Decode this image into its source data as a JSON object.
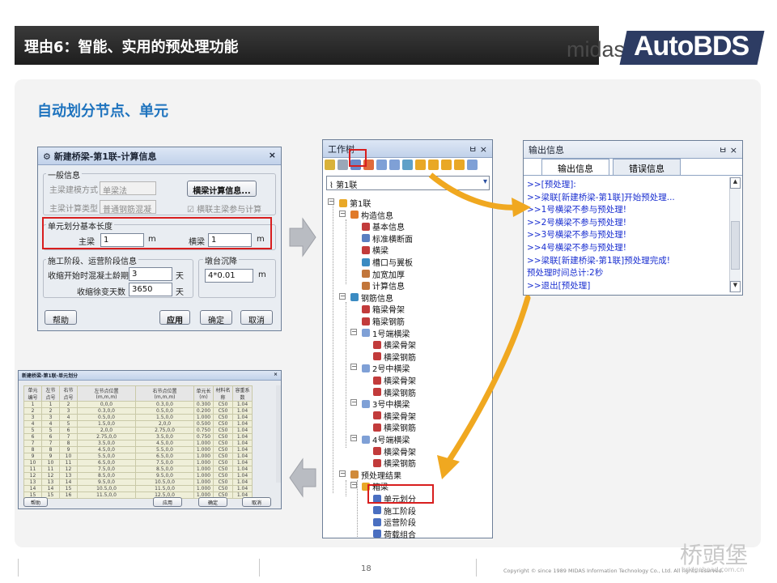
{
  "header": {
    "title": "理由6：智能、实用的预处理功能",
    "logo_midas": "midas",
    "logo_product": "AutoBDS"
  },
  "subtitle": "自动划分节点、单元",
  "dialog": {
    "title": "新建桥梁-第1联-计算信息",
    "close": "×",
    "general_group": "一般信息",
    "model_method_label": "主梁建模方式",
    "model_method_value": "单梁法",
    "calc_type_label": "主梁计算类型",
    "calc_type_value": "普通钢筋混凝",
    "crossbeam_button": "横梁计算信息...",
    "crossbeam_check_label": "横联主梁参与计算",
    "element_group": "单元划分基本长度",
    "main_beam_label": "主梁",
    "main_beam_value": "1",
    "main_beam_unit": "m",
    "crossbeam_label": "横梁",
    "crossbeam_value": "1",
    "crossbeam_unit": "m",
    "stage_group": "施工阶段、运营阶段信息",
    "shrink_start_label": "收缩开始时混凝土龄期",
    "shrink_start_value": "3",
    "shrink_start_unit": "天",
    "shrink_days_label": "收缩徐变天数",
    "shrink_days_value": "3650",
    "shrink_days_unit": "天",
    "settle_group": "墩台沉降",
    "settle_value": "4*0.01",
    "settle_unit": "m",
    "help_button": "帮助",
    "apply_button": "应用",
    "ok_button": "确定",
    "cancel_button": "取消"
  },
  "tree": {
    "title": "工作树",
    "pin": "ㅂ",
    "close": "×",
    "selector": "第1联",
    "nodes": [
      {
        "label": "第1联"
      },
      {
        "label": "构造信息"
      },
      {
        "label": "基本信息"
      },
      {
        "label": "标准横断面"
      },
      {
        "label": "横梁"
      },
      {
        "label": "槽口与翼板"
      },
      {
        "label": "加宽加厚"
      },
      {
        "label": "计算信息"
      },
      {
        "label": "钢筋信息"
      },
      {
        "label": "箱梁骨架"
      },
      {
        "label": "箱梁钢筋"
      },
      {
        "label": "1号端横梁"
      },
      {
        "label": "横梁骨架"
      },
      {
        "label": "横梁钢筋"
      },
      {
        "label": "2号中横梁"
      },
      {
        "label": "横梁骨架"
      },
      {
        "label": "横梁钢筋"
      },
      {
        "label": "3号中横梁"
      },
      {
        "label": "横梁骨架"
      },
      {
        "label": "横梁钢筋"
      },
      {
        "label": "4号端横梁"
      },
      {
        "label": "横梁骨架"
      },
      {
        "label": "横梁钢筋"
      },
      {
        "label": "预处理结果"
      },
      {
        "label": "箱梁"
      },
      {
        "label": "单元划分"
      },
      {
        "label": "施工阶段"
      },
      {
        "label": "运营阶段"
      },
      {
        "label": "荷载组合"
      }
    ]
  },
  "output": {
    "title": "输出信息",
    "pin": "ㅂ",
    "close": "×",
    "tab_output": "输出信息",
    "tab_errors": "错误信息",
    "lines": [
      ">>[预处理]:",
      ">>梁联[新建桥梁-第1联]开始预处理...",
      ">>1号横梁不参与预处理!",
      ">>2号横梁不参与预处理!",
      ">>3号横梁不参与预处理!",
      ">>4号横梁不参与预处理!",
      ">>梁联[新建桥梁-第1联]预处理完成!",
      "预处理时间总计:2秒",
      ">>退出[预处理]"
    ]
  },
  "table_window": {
    "title": "新建桥梁-第1联-单元划分",
    "headers": [
      "单元编号",
      "左节点号",
      "右节点号",
      "左节点位置\n(m,m,m)",
      "右节点位置\n(m,m,m)",
      "单元长\n(m)",
      "材料名称",
      "容重系数"
    ],
    "rows": [
      [
        "1",
        "1",
        "2",
        "0,0,0",
        "0.3,0,0",
        "0.300",
        "C50",
        "1.04"
      ],
      [
        "2",
        "2",
        "3",
        "0.3,0,0",
        "0.5,0,0",
        "0.200",
        "C50",
        "1.04"
      ],
      [
        "3",
        "3",
        "4",
        "0.5,0,0",
        "1.5,0,0",
        "1.000",
        "C50",
        "1.04"
      ],
      [
        "4",
        "4",
        "5",
        "1.5,0,0",
        "2,0,0",
        "0.500",
        "C50",
        "1.04"
      ],
      [
        "5",
        "5",
        "6",
        "2,0,0",
        "2.75,0,0",
        "0.750",
        "C50",
        "1.04"
      ],
      [
        "6",
        "6",
        "7",
        "2.75,0,0",
        "3.5,0,0",
        "0.750",
        "C50",
        "1.04"
      ],
      [
        "7",
        "7",
        "8",
        "3.5,0,0",
        "4.5,0,0",
        "1.000",
        "C50",
        "1.04"
      ],
      [
        "8",
        "8",
        "9",
        "4.5,0,0",
        "5.5,0,0",
        "1.000",
        "C50",
        "1.04"
      ],
      [
        "9",
        "9",
        "10",
        "5.5,0,0",
        "6.5,0,0",
        "1.000",
        "C50",
        "1.04"
      ],
      [
        "10",
        "10",
        "11",
        "6.5,0,0",
        "7.5,0,0",
        "1.000",
        "C50",
        "1.04"
      ],
      [
        "11",
        "11",
        "12",
        "7.5,0,0",
        "8.5,0,0",
        "1.000",
        "C50",
        "1.04"
      ],
      [
        "12",
        "12",
        "13",
        "8.5,0,0",
        "9.5,0,0",
        "1.000",
        "C50",
        "1.04"
      ],
      [
        "13",
        "13",
        "14",
        "9.5,0,0",
        "10.5,0,0",
        "1.000",
        "C50",
        "1.04"
      ],
      [
        "14",
        "14",
        "15",
        "10.5,0,0",
        "11.5,0,0",
        "1.000",
        "C50",
        "1.04"
      ],
      [
        "15",
        "15",
        "16",
        "11.5,0,0",
        "12.5,0,0",
        "1.000",
        "C50",
        "1.04"
      ]
    ],
    "help_button": "帮助",
    "apply_button": "应用",
    "ok_button": "确定",
    "cancel_button": "取消"
  },
  "footer": {
    "page_number": "18",
    "copyright": "Copyright © since 1989 MIDAS Information Technology Co., Ltd. All rights reserved.",
    "watermark": "桥頭堡",
    "watermark_url": "bridgehead.com.cn"
  },
  "colors": {
    "accent_blue": "#1e73be",
    "highlight_red": "#d81e1e",
    "arrow_orange": "#f0a820",
    "logo_navy": "#2d3c63"
  }
}
